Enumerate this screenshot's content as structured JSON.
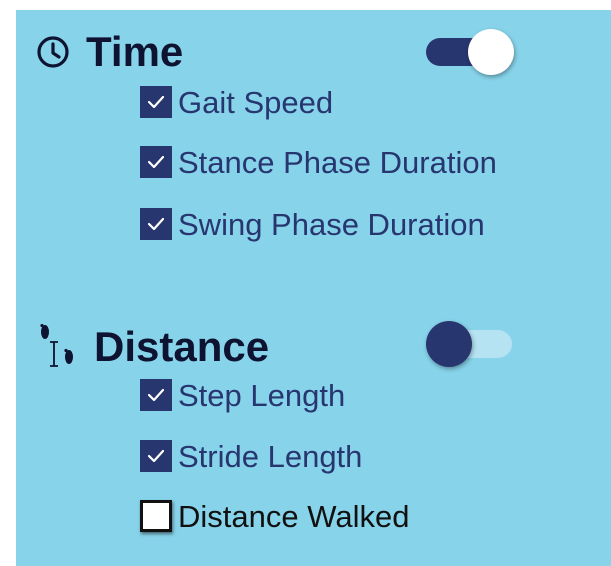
{
  "sections": [
    {
      "title": "Time",
      "icon": "clock-icon",
      "toggle_on": true,
      "items": [
        {
          "label": "Gait Speed",
          "checked": true
        },
        {
          "label": "Stance Phase Duration",
          "checked": true
        },
        {
          "label": "Swing Phase Duration",
          "checked": true
        }
      ]
    },
    {
      "title": "Distance",
      "icon": "footsteps-distance-icon",
      "toggle_on": false,
      "items": [
        {
          "label": "Step Length",
          "checked": true
        },
        {
          "label": "Stride Length",
          "checked": true
        },
        {
          "label": "Distance Walked",
          "checked": false
        }
      ]
    }
  ],
  "colors": {
    "panel_bg": "#87d3ea",
    "accent": "#283670",
    "title_text": "#0d1330",
    "toggle_off_track": "#b5e3f2"
  }
}
